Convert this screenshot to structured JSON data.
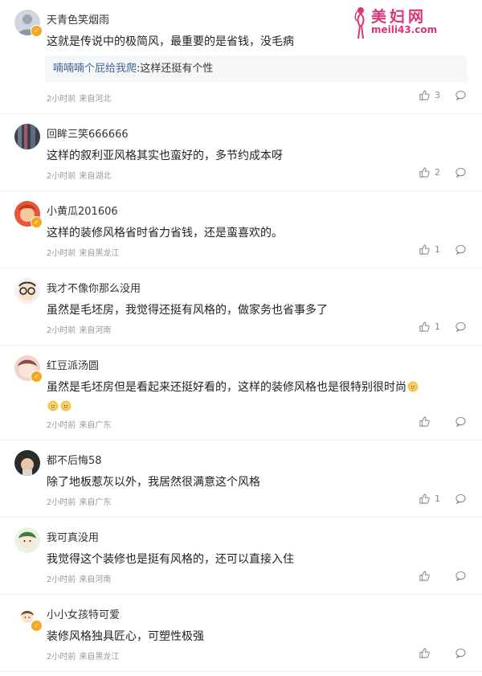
{
  "watermark": {
    "title": "美妇网",
    "url": "meili43.com"
  },
  "comments": [
    {
      "user": "天青色笑烟雨",
      "text": "这就是传说中的极简风，最重要的是省钱，没毛病",
      "reply_user": "喃喃喃个屁给我爬",
      "reply_text": ":这样还挺有个性",
      "time": "2小时前",
      "location": "来自河北",
      "likes": "3"
    },
    {
      "user": "回眸三笑666666",
      "text": "这样的叙利亚风格其实也蛮好的，多节约成本呀",
      "time": "2小时前",
      "location": "来自湖北",
      "likes": "2"
    },
    {
      "user": "小黄瓜201606",
      "text": "这样的装修风格省时省力省钱，还是蛮喜欢的。",
      "time": "2小时前",
      "location": "来自黑龙江",
      "likes": "1"
    },
    {
      "user": "我才不像你那么没用",
      "text": "虽然是毛坯房，我觉得还挺有风格的，做家务也省事多了",
      "time": "2小时前",
      "location": "来自河南",
      "likes": "1"
    },
    {
      "user": "红豆派汤圆",
      "text": "虽然是毛坯房但是看起来还挺好看的，这样的装修风格也是很特别很时尚",
      "time": "2小时前",
      "location": "来自广东",
      "likes": ""
    },
    {
      "user": "都不后悔58",
      "text": "除了地板惹灰以外，我居然很满意这个风格",
      "time": "2小时前",
      "location": "来自广东",
      "likes": "1"
    },
    {
      "user": "我可真没用",
      "text": "我觉得这个装修也是挺有风格的，还可以直接入住",
      "time": "2小时前",
      "location": "来自河南",
      "likes": ""
    },
    {
      "user": "小小女孩特可爱",
      "text": "装修风格独具匠心，可塑性极强",
      "time": "2小时前",
      "location": "来自黑龙江",
      "likes": ""
    }
  ],
  "colors": {
    "link": "#406599",
    "badge": "#f5a623",
    "watermark": "#d8357a"
  }
}
